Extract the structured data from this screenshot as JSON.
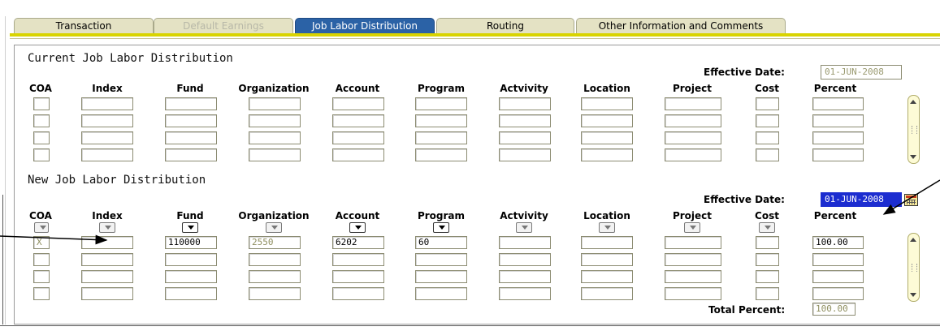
{
  "tabs": [
    {
      "label": "Transaction",
      "state": "normal"
    },
    {
      "label": "Default Earnings",
      "state": "disabled"
    },
    {
      "label": "Job Labor Distribution",
      "state": "active"
    },
    {
      "label": "Routing",
      "state": "normal"
    },
    {
      "label": "Other Information and Comments",
      "state": "normal"
    }
  ],
  "current": {
    "title": "Current Job Labor Distribution",
    "effective_date_label": "Effective Date:",
    "effective_date": "01-JUN-2008"
  },
  "new": {
    "title": "New Job Labor Distribution",
    "effective_date_label": "Effective Date:",
    "effective_date": "01-JUN-2008",
    "total_percent_label": "Total Percent:",
    "total_percent": "100.00",
    "row1": {
      "coa": "X",
      "index": "",
      "fund": "110000",
      "organization": "2550",
      "account": "6202",
      "program": "60",
      "activity": "",
      "location": "",
      "project": "",
      "cost": "",
      "percent": "100.00"
    }
  },
  "columns": [
    "COA",
    "Index",
    "Fund",
    "Organization",
    "Account",
    "Program",
    "Actvivity",
    "Location",
    "Project",
    "Cost",
    "Percent"
  ],
  "icons": {
    "dropdown": "chevron-down-icon",
    "calendar": "calendar-icon",
    "scroll_up": "arrow-up-icon",
    "scroll_down": "arrow-down-icon"
  },
  "colors": {
    "active_tab": "#2b62a6",
    "tab_bg": "#e4e2c4",
    "accent_line": "#d9d400",
    "selected_date_bg": "#1c2dd0"
  }
}
